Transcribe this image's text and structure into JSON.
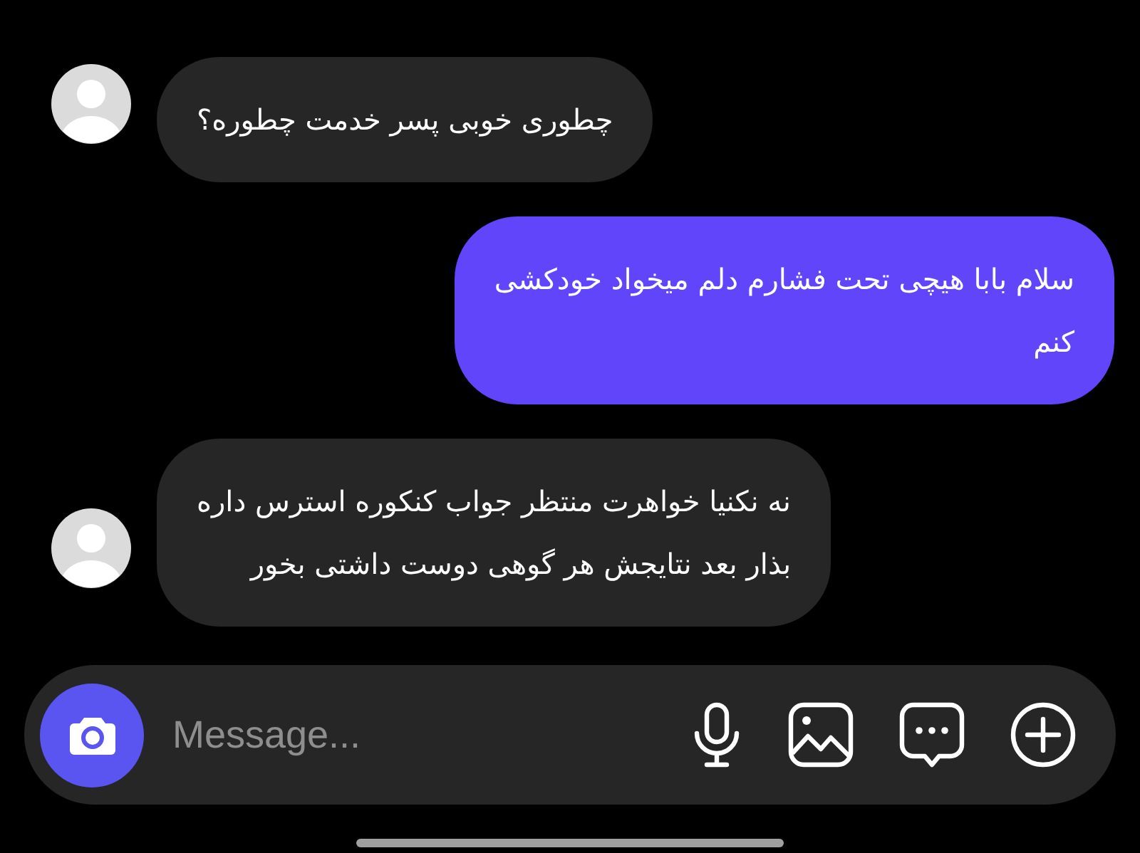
{
  "messages": [
    {
      "kind": "incoming",
      "text": "چطوری خوبی پسر خدمت چطوره؟"
    },
    {
      "kind": "outgoing",
      "text": "سلام بابا هیچی تحت فشارم دلم میخواد خودکشی\nکنم"
    },
    {
      "kind": "incoming",
      "text": "نه نکنیا خواهرت منتظر جواب کنکوره استرس داره\nبذار بعد نتایجش هر گوهی دوست داشتی بخور"
    }
  ],
  "composer": {
    "placeholder": "Message..."
  }
}
